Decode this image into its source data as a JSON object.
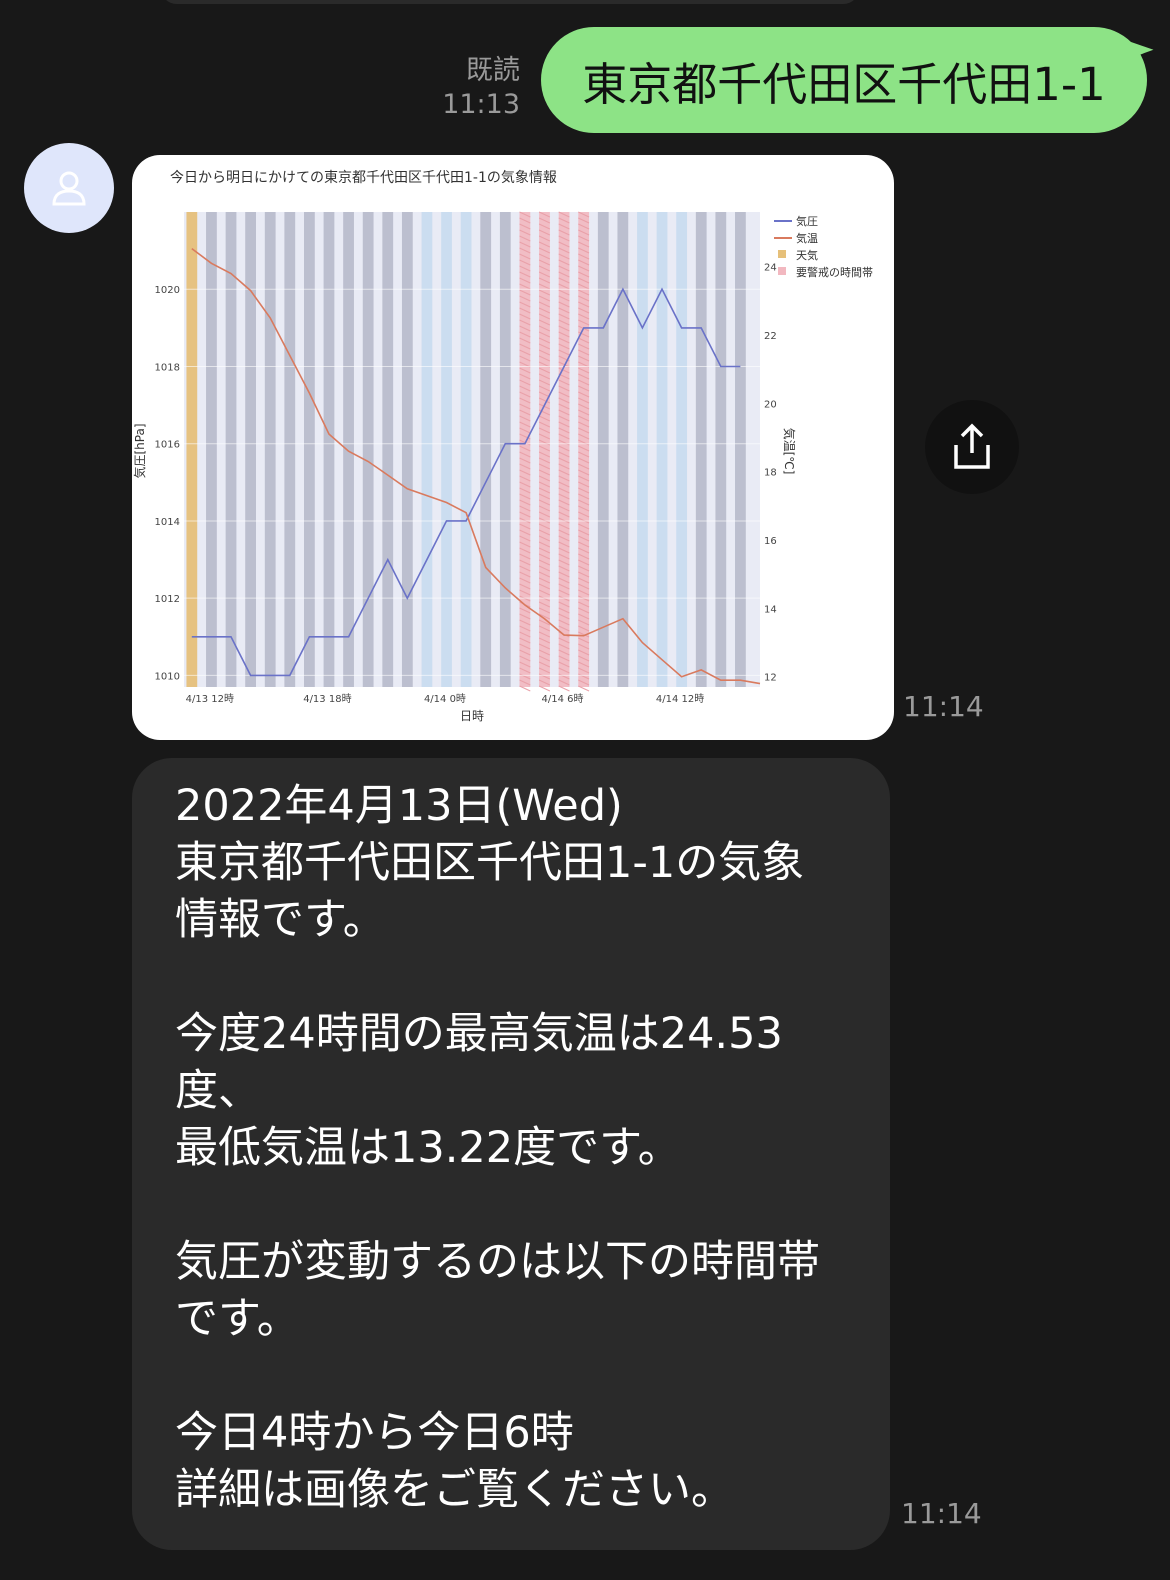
{
  "app": {
    "name": "LINE chat"
  },
  "sent": {
    "read_label": "既読",
    "time": "11:13",
    "text": "東京都千代田区千代田1-1"
  },
  "image_message": {
    "time": "11:14",
    "share_icon": "share-icon"
  },
  "text_message": {
    "time": "11:14",
    "text": "2022年4月13日(Wed)\n東京都千代田区千代田1-1の気象\n情報です。\n\n今度24時間の最高気温は24.53\n度、\n最低気温は13.22度です。\n\n気圧が変動するのは以下の時間帯\nです。\n\n今日4時から今日6時\n詳細は画像をご覧ください。"
  },
  "chart_data": {
    "type": "line",
    "title": "今日から明日にかけての東京都千代田区千代田1-1の気象情報",
    "xlabel": "日時",
    "ylabel_left": "気圧[hPa]",
    "ylabel_right": "気温[℃]",
    "x_ticks": [
      "4/13 12時",
      "4/13 18時",
      "4/14 0時",
      "4/14 6時",
      "4/14 12時"
    ],
    "x_tick_hours": [
      0,
      6,
      12,
      18,
      24
    ],
    "y_left_ticks": [
      1010,
      1012,
      1014,
      1016,
      1018,
      1020
    ],
    "y_left_range": [
      1009.7,
      1022.0
    ],
    "y_right_ticks": [
      12,
      14,
      16,
      18,
      20,
      22,
      24
    ],
    "y_right_range": [
      11.7,
      25.6
    ],
    "x_range": [
      -0.4,
      29.0
    ],
    "legend": [
      {
        "name": "気圧",
        "color": "#6a72c8"
      },
      {
        "name": "気温",
        "color": "#d97a5e"
      },
      {
        "name": "天気",
        "color": "#e6c07a"
      },
      {
        "name": "要警戒の時間帯",
        "color": "#f2b8c0"
      }
    ],
    "legend_position": "top-right",
    "series": [
      {
        "name": "気圧",
        "axis": "left",
        "x": [
          0,
          1,
          2,
          3,
          4,
          5,
          6,
          7,
          8,
          9,
          10,
          11,
          12,
          13,
          14,
          15,
          16,
          17,
          18,
          19,
          20,
          21,
          22,
          23,
          24,
          25,
          26,
          27,
          28
        ],
        "values": [
          1011,
          1011,
          1011,
          1010,
          1010,
          1010,
          1011,
          1011,
          1011,
          1012,
          1013,
          1012,
          1013,
          1014,
          1014,
          1015,
          1016,
          1016,
          1017,
          1018,
          1019,
          1019,
          1020,
          1019,
          1020,
          1019,
          1019,
          1018,
          1018
        ]
      },
      {
        "name": "気温",
        "axis": "right",
        "x": [
          0,
          1,
          2,
          3,
          4,
          5,
          6,
          7,
          8,
          9,
          10,
          11,
          12,
          13,
          14,
          15,
          16,
          17,
          18,
          19,
          20,
          21,
          22,
          23,
          24,
          25,
          26,
          27,
          28,
          29
        ],
        "values": [
          24.53,
          24.1,
          23.8,
          23.3,
          22.5,
          21.4,
          20.3,
          19.1,
          18.6,
          18.3,
          17.9,
          17.5,
          17.3,
          17.1,
          16.8,
          15.2,
          14.6,
          14.1,
          13.7,
          13.22,
          13.2,
          13.45,
          13.7,
          13.0,
          12.5,
          12.0,
          12.2,
          11.9,
          11.9,
          11.8
        ]
      }
    ],
    "bands": [
      {
        "x": 0,
        "kind": "weather",
        "color": "#e6c07a"
      },
      {
        "x": 1,
        "kind": "cloudy",
        "color": "#b9bdcc"
      },
      {
        "x": 2,
        "kind": "cloudy",
        "color": "#b9bdcc"
      },
      {
        "x": 3,
        "kind": "cloudy",
        "color": "#b9bdcc"
      },
      {
        "x": 4,
        "kind": "cloudy",
        "color": "#b9bdcc"
      },
      {
        "x": 5,
        "kind": "cloudy",
        "color": "#b9bdcc"
      },
      {
        "x": 6,
        "kind": "cloudy",
        "color": "#b9bdcc"
      },
      {
        "x": 7,
        "kind": "cloudy",
        "color": "#b9bdcc"
      },
      {
        "x": 8,
        "kind": "cloudy",
        "color": "#b9bdcc"
      },
      {
        "x": 9,
        "kind": "cloudy",
        "color": "#b9bdcc"
      },
      {
        "x": 10,
        "kind": "cloudy",
        "color": "#b9bdcc"
      },
      {
        "x": 11,
        "kind": "cloudy",
        "color": "#b9bdcc"
      },
      {
        "x": 12,
        "kind": "rain",
        "color": "#c9dcef"
      },
      {
        "x": 13,
        "kind": "rain",
        "color": "#c9dcef"
      },
      {
        "x": 14,
        "kind": "rain",
        "color": "#c9dcef"
      },
      {
        "x": 15,
        "kind": "cloudy",
        "color": "#b9bdcc"
      },
      {
        "x": 16,
        "kind": "cloudy",
        "color": "#b9bdcc"
      },
      {
        "x": 17,
        "kind": "alert",
        "color": "#f2b8c0"
      },
      {
        "x": 18,
        "kind": "alert",
        "color": "#f2b8c0"
      },
      {
        "x": 19,
        "kind": "alert",
        "color": "#f2b8c0"
      },
      {
        "x": 20,
        "kind": "alert",
        "color": "#f2b8c0"
      },
      {
        "x": 21,
        "kind": "cloudy",
        "color": "#b9bdcc"
      },
      {
        "x": 22,
        "kind": "cloudy",
        "color": "#b9bdcc"
      },
      {
        "x": 23,
        "kind": "rain",
        "color": "#c9dcef"
      },
      {
        "x": 24,
        "kind": "rain",
        "color": "#c9dcef"
      },
      {
        "x": 25,
        "kind": "rain",
        "color": "#c9dcef"
      },
      {
        "x": 26,
        "kind": "cloudy",
        "color": "#b9bdcc"
      },
      {
        "x": 27,
        "kind": "cloudy",
        "color": "#b9bdcc"
      },
      {
        "x": 28,
        "kind": "cloudy",
        "color": "#b9bdcc"
      }
    ],
    "grid": true
  }
}
